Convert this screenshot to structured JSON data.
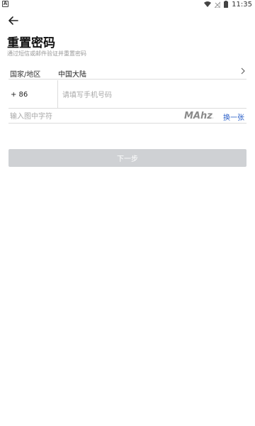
{
  "status_bar": {
    "notification_letter": "A",
    "time": "11:35"
  },
  "header": {
    "title": "重置密码",
    "subtitle": "通过短信或邮件验证并重置密码"
  },
  "form": {
    "region_label": "国家/地区",
    "region_value": "中国大陆",
    "country_code": "+ 86",
    "phone_placeholder": "请填写手机号码",
    "captcha_placeholder": "输入图中字符",
    "captcha_text": "MAhz1",
    "captcha_refresh_label": "换一张",
    "next_label": "下一步"
  },
  "colors": {
    "link": "#2f63c9",
    "button_disabled": "#cfd1d4",
    "divider": "#dcdcdc"
  }
}
